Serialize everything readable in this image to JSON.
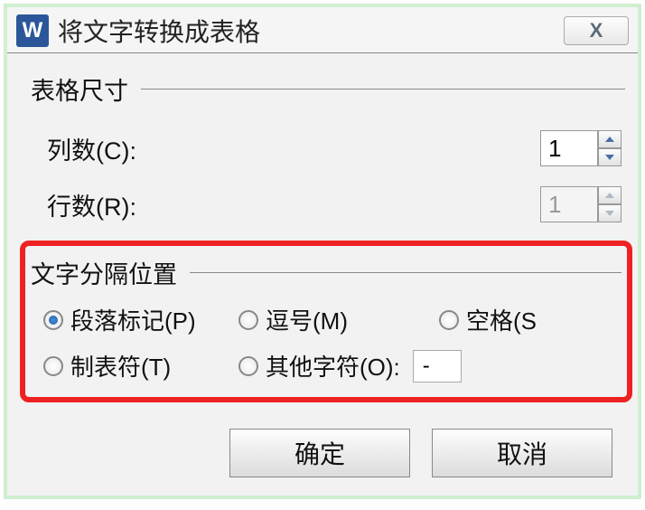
{
  "titlebar": {
    "icon_letter": "W",
    "title": "将文字转换成表格",
    "close_glyph": "X"
  },
  "table_size": {
    "group_label": "表格尺寸",
    "columns_label": "列数(C):",
    "columns_value": "1",
    "rows_label": "行数(R):",
    "rows_value": "1"
  },
  "separator": {
    "group_label": "文字分隔位置",
    "options": {
      "paragraph": "段落标记(P)",
      "comma": "逗号(M)",
      "space": "空格(S",
      "tab": "制表符(T)",
      "other": "其他字符(O):"
    },
    "other_value": "-",
    "selected": "paragraph"
  },
  "buttons": {
    "ok": "确定",
    "cancel": "取消"
  }
}
